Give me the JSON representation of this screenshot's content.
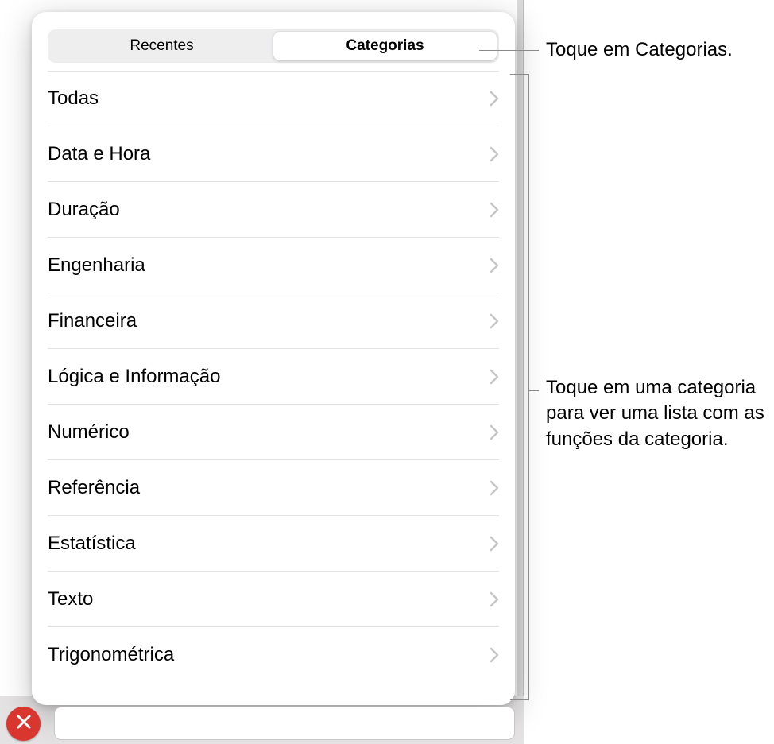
{
  "segmented": {
    "recents": "Recentes",
    "categories": "Categorias"
  },
  "categories": [
    {
      "label": "Todas"
    },
    {
      "label": "Data e Hora"
    },
    {
      "label": "Duração"
    },
    {
      "label": "Engenharia"
    },
    {
      "label": "Financeira"
    },
    {
      "label": "Lógica e Informação"
    },
    {
      "label": "Numérico"
    },
    {
      "label": "Referência"
    },
    {
      "label": "Estatística"
    },
    {
      "label": "Texto"
    },
    {
      "label": "Trigonométrica"
    }
  ],
  "callouts": {
    "tap_categories": "Toque em Categorias.",
    "tap_category_list": "Toque em uma categoria para ver uma lista com as funções da categoria."
  }
}
